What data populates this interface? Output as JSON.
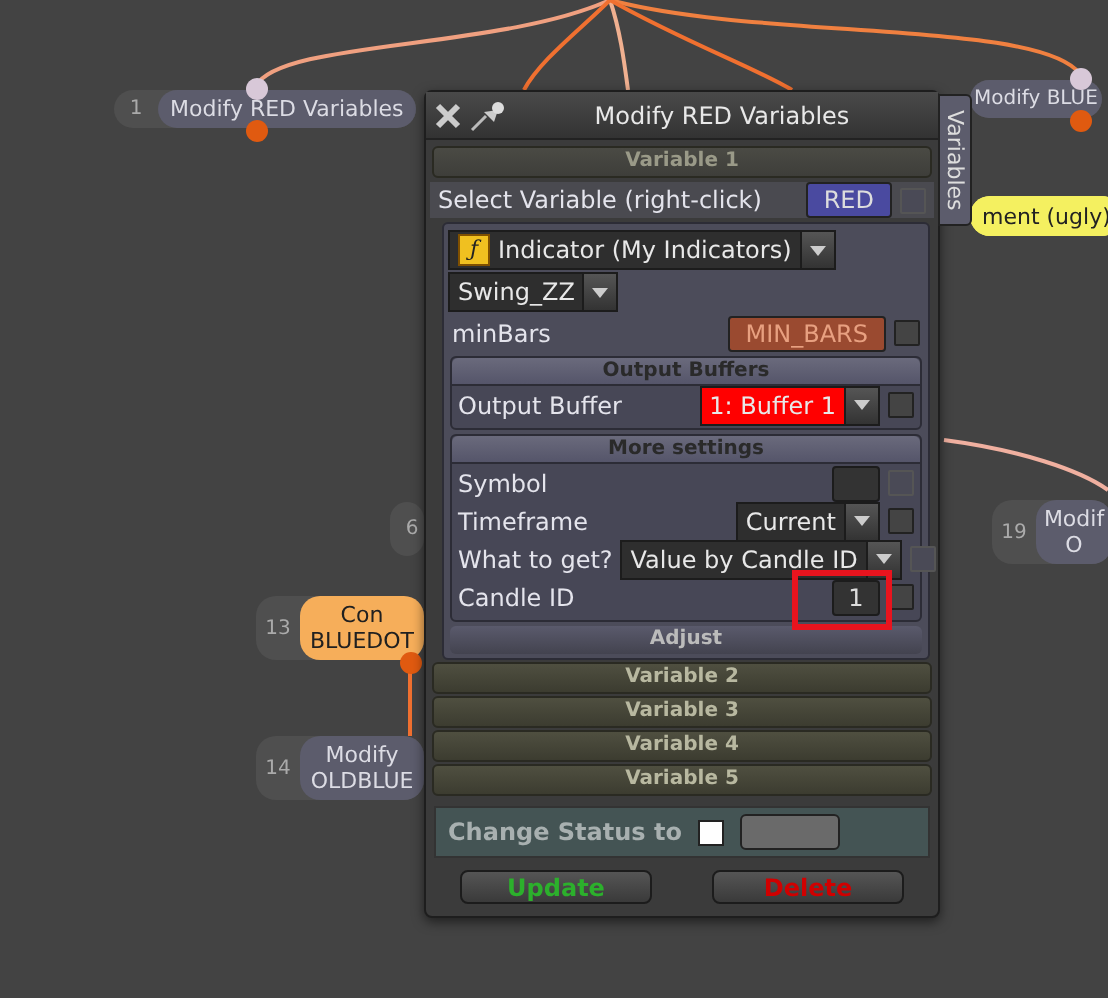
{
  "canvas": {
    "nodes": [
      {
        "kind": "normal",
        "number": "1",
        "lines": [
          "Modify RED Variables"
        ]
      },
      {
        "kind": "normal",
        "lines": [
          "Modify BLUE"
        ]
      },
      {
        "kind": "comment",
        "lines": [
          "ment (ugly)"
        ]
      },
      {
        "kind": "normal",
        "number": "6"
      },
      {
        "kind": "normal",
        "number": "19",
        "lines": [
          "Modif",
          "O"
        ]
      },
      {
        "kind": "condition",
        "number": "13",
        "lines": [
          "Con",
          "BLUEDOT"
        ]
      },
      {
        "kind": "normal",
        "number": "14",
        "lines": [
          "Modify",
          "OLDBLUE"
        ]
      }
    ]
  },
  "dialog": {
    "title": "Modify RED Variables",
    "side_tab": "Variables",
    "variable": {
      "header": "Variable 1",
      "select_label": "Select Variable (right-click)",
      "variable_badge": {
        "text": "RED",
        "color": "#4a4aa0"
      },
      "select_checkbox": {
        "checked": false,
        "disabled": true
      },
      "indicator_icon": "ƒ",
      "indicator_type": "Indicator (My Indicators)",
      "indicator": "Swing_ZZ",
      "params": [
        {
          "label": "minBars",
          "kind": "badge",
          "value": "MIN_BARS",
          "color": "#9a4a30",
          "checkbox": {
            "checked": false,
            "disabled": false
          }
        }
      ],
      "groups": [
        {
          "header": "Output Buffers",
          "rows": [
            {
              "label": "Output Buffer",
              "kind": "dropdown",
              "value": "1: Buffer 1",
              "color": "#ff0000",
              "checkbox": {
                "checked": false,
                "disabled": false
              },
              "highlighted": false
            }
          ]
        },
        {
          "header": "More settings",
          "rows": [
            {
              "label": "Symbol",
              "kind": "field",
              "value": "",
              "checkbox": {
                "checked": false,
                "disabled": true
              },
              "highlighted": false
            },
            {
              "label": "Timeframe",
              "kind": "dropdown",
              "value": "Current",
              "color": "#2e2e2e",
              "checkbox": {
                "checked": false,
                "disabled": false
              },
              "highlighted": false
            },
            {
              "label": "What to get?",
              "kind": "dropdown",
              "value": "Value by Candle ID",
              "color": "#2e2e2e",
              "checkbox": {
                "checked": false,
                "disabled": true
              },
              "highlighted": false
            },
            {
              "label": "Candle ID",
              "kind": "field",
              "value": "1",
              "checkbox": {
                "checked": false,
                "disabled": false
              },
              "highlighted": true
            }
          ]
        }
      ],
      "footer": "Adjust"
    },
    "collapsed_sections": [
      "Variable 2",
      "Variable 3",
      "Variable 4",
      "Variable 5"
    ],
    "status": {
      "label": "Change Status to",
      "checked": false
    },
    "buttons": [
      {
        "label": "Update",
        "kind": "update"
      },
      {
        "label": "Delete",
        "kind": "delete"
      }
    ]
  }
}
